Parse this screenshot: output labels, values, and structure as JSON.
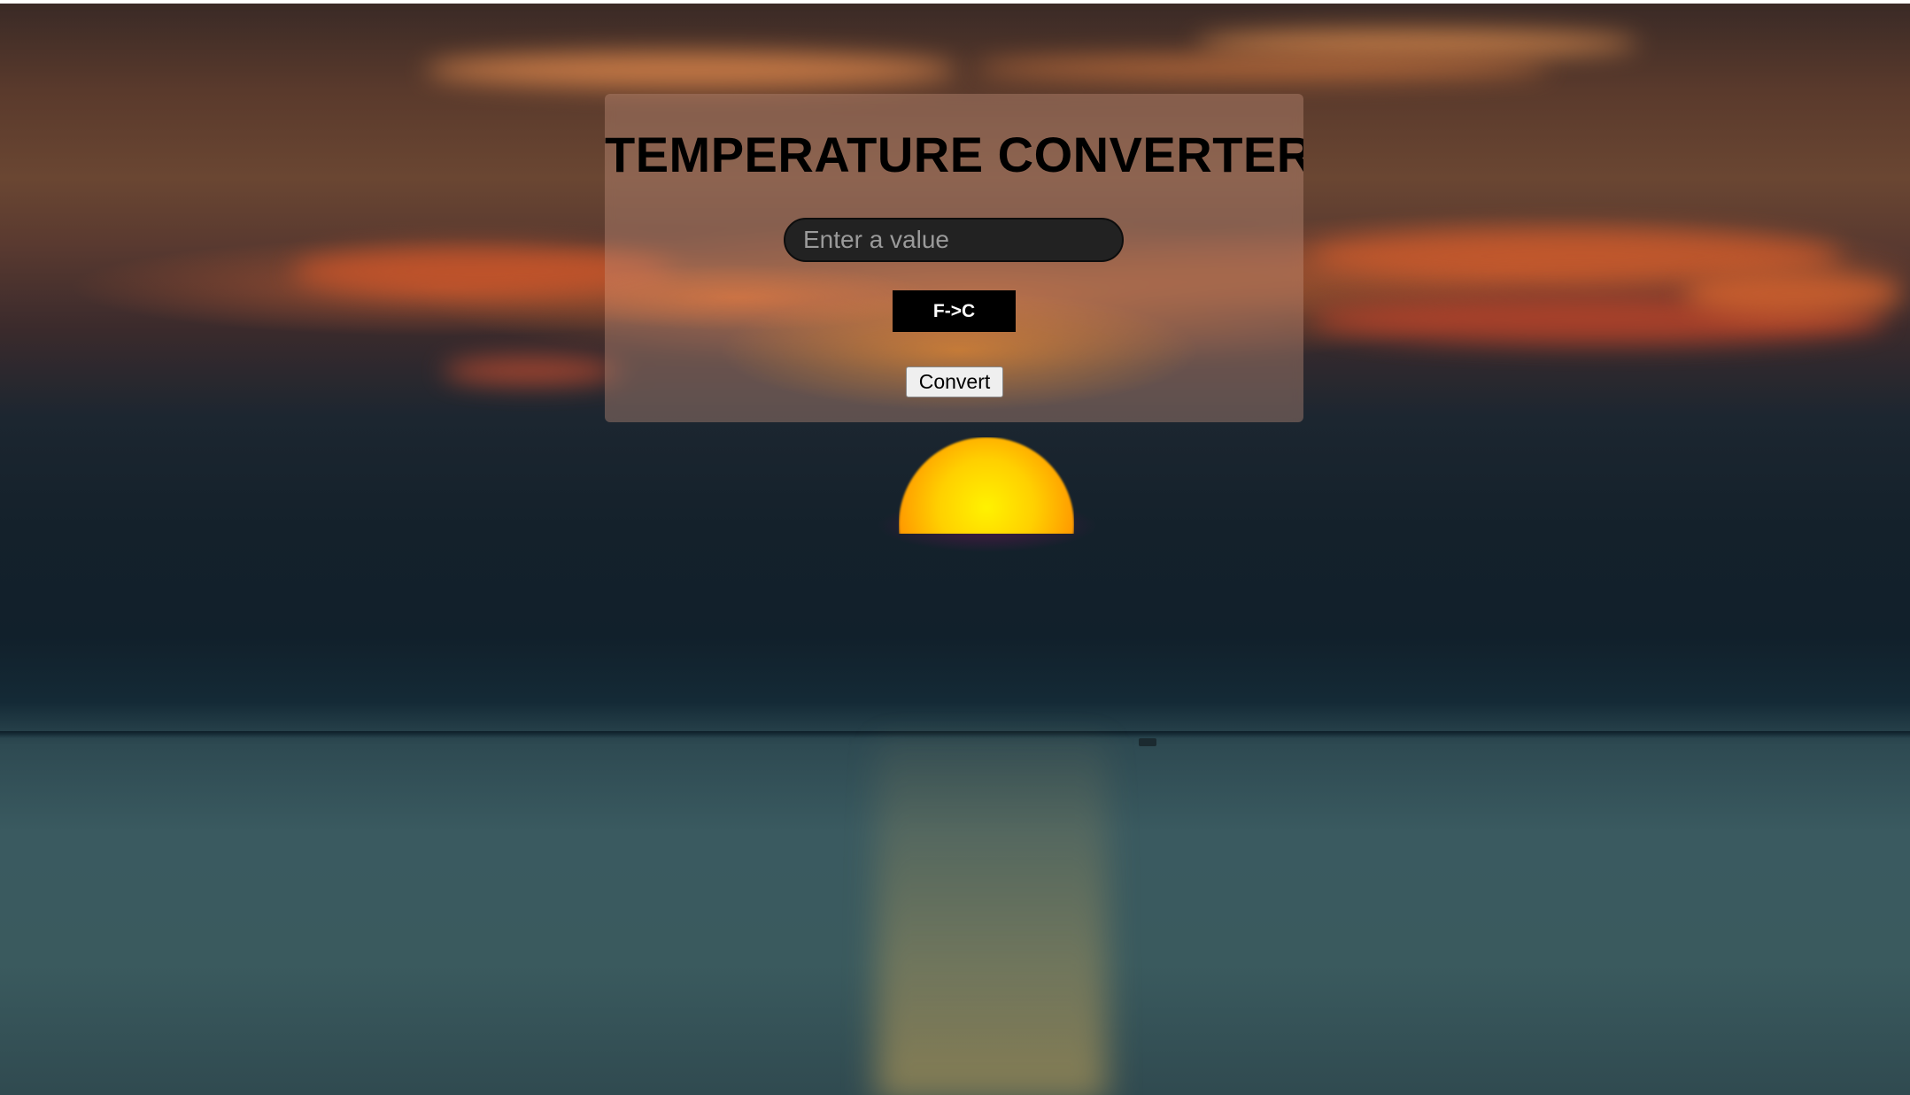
{
  "app": {
    "title": "TEMPERATURE CONVERTER"
  },
  "form": {
    "input": {
      "placeholder": "Enter a value",
      "value": ""
    },
    "unit_toggle_label": "F->C",
    "convert_label": "Convert"
  },
  "colors": {
    "input_background": "#222222",
    "toggle_background": "#000000",
    "toggle_text": "#ffffff",
    "title_text": "#000000"
  }
}
